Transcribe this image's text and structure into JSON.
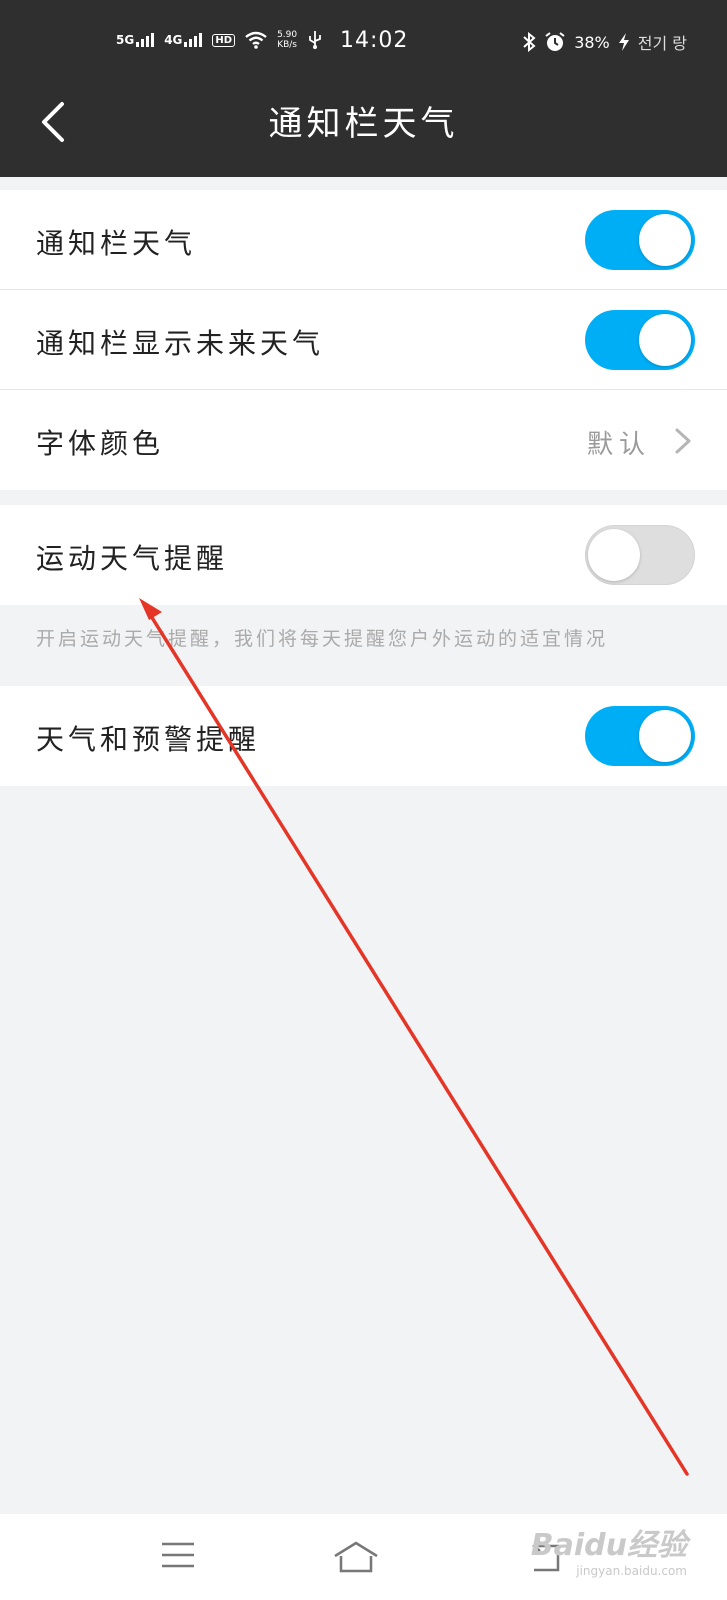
{
  "status_bar": {
    "net1": "5G",
    "net2": "4G",
    "hd": "HD",
    "speed_value": "5.90",
    "speed_unit": "KB/s",
    "time": "14:02",
    "battery": "38%",
    "carrier": "전기 랑"
  },
  "header": {
    "title": "通知栏天气"
  },
  "group1": {
    "rows": [
      {
        "label": "通知栏天气",
        "toggle": "on"
      },
      {
        "label": "通知栏显示未来天气",
        "toggle": "on"
      },
      {
        "label": "字体颜色",
        "value": "默认"
      }
    ]
  },
  "group2": {
    "rows": [
      {
        "label": "运动天气提醒",
        "toggle": "off"
      }
    ],
    "hint": "开启运动天气提醒，我们将每天提醒您户外运动的适宜情况"
  },
  "group3": {
    "rows": [
      {
        "label": "天气和预警提醒",
        "toggle": "on"
      }
    ]
  },
  "watermark": {
    "brand": "Baidu经验",
    "url": "jingyan.baidu.com"
  },
  "colors": {
    "toggle_on": "#00aef6",
    "toggle_off": "#dedede",
    "header_bg": "#2f2f2f",
    "annotation": "#e53526"
  },
  "icons": [
    "back-arrow-icon",
    "chevron-right-icon",
    "menu-icon",
    "home-icon",
    "return-icon",
    "wifi-icon",
    "bluetooth-icon",
    "alarm-icon",
    "usb-icon",
    "charging-icon"
  ]
}
